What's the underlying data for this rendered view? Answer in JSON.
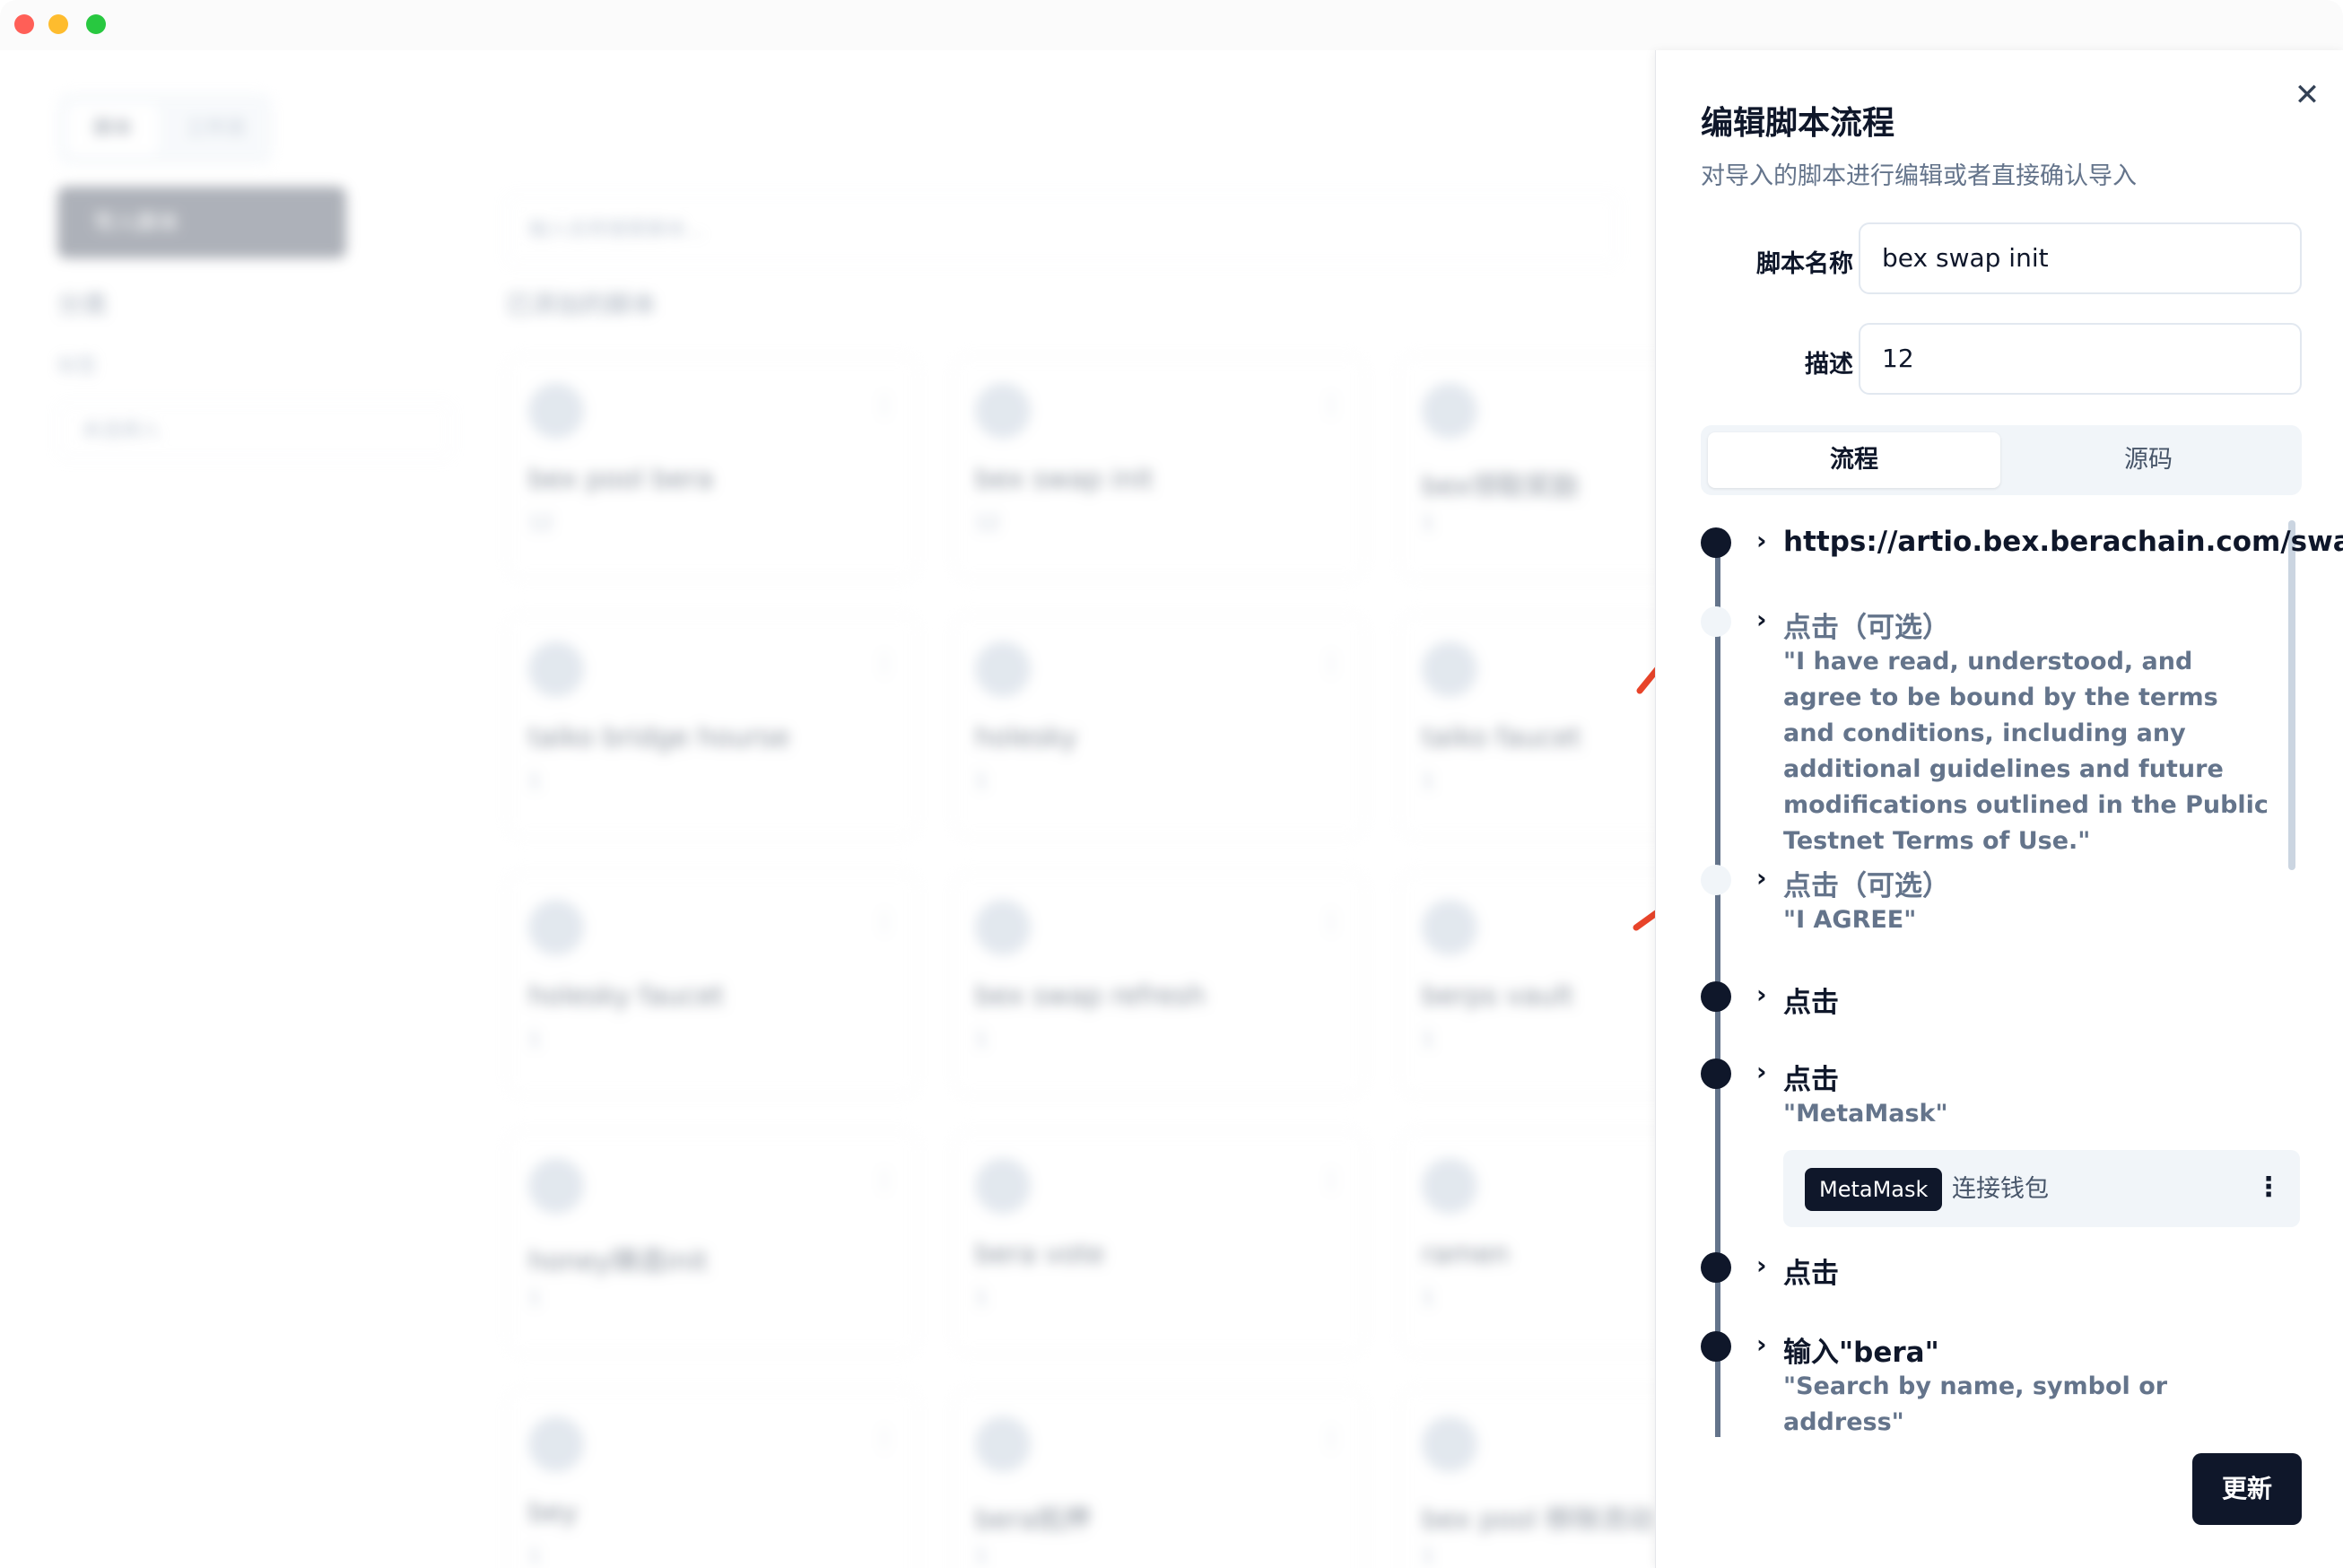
{
  "background_app": {
    "tabs": [
      "脚本",
      "工作流"
    ],
    "primary_button": "导入脚本",
    "sidebar_title": "分类",
    "sidebar_sub": "标签",
    "sidebar_select": "未选择入",
    "search_placeholder": "输入名称搜索脚本...",
    "section_title": "已添加的脚本",
    "cards": [
      {
        "name": "bex pool bera",
        "desc": "12"
      },
      {
        "name": "bex swap init",
        "desc": "12"
      },
      {
        "name": "bex领取奖励",
        "desc": "1"
      },
      {
        "name": "taiko bridge hourse",
        "desc": "1"
      },
      {
        "name": "holesky",
        "desc": "1"
      },
      {
        "name": "taiko faucet",
        "desc": "1"
      },
      {
        "name": "holesky faucet",
        "desc": "1"
      },
      {
        "name": "bex swap refresh",
        "desc": "1"
      },
      {
        "name": "berps vault",
        "desc": "1"
      },
      {
        "name": "honey铸造init",
        "desc": "1"
      },
      {
        "name": "bera vote",
        "desc": "1"
      },
      {
        "name": "ramen",
        "desc": "1"
      },
      {
        "name": "bey",
        "desc": "1"
      },
      {
        "name": "bera抵押",
        "desc": "1"
      },
      {
        "name": "bex pool 移除流动",
        "desc": "1"
      }
    ]
  },
  "drawer": {
    "close_icon": "close-icon",
    "title": "编辑脚本流程",
    "subtitle": "对导入的脚本进行编辑或者直接确认导入",
    "name_label": "脚本名称",
    "name_value": "bex swap init",
    "desc_label": "描述",
    "desc_value": "12",
    "tabs": {
      "flow": "流程",
      "source": "源码"
    },
    "steps": [
      {
        "title": "https://artio.bex.berachain.com/swap",
        "desc": ""
      },
      {
        "title": "点击（可选）",
        "desc": "\"I have read, understood, and agree to be bound by the terms and conditions, including any additional guidelines and future modifications outlined in the Public Testnet Terms of Use.\""
      },
      {
        "title": "点击（可选）",
        "desc": "\"I AGREE\""
      },
      {
        "title": "点击",
        "desc": ""
      },
      {
        "title": "点击",
        "desc": "\"MetaMask\""
      },
      {
        "title": "点击",
        "desc": ""
      },
      {
        "title": "输入\"bera\"",
        "desc": "\"Search by name, symbol or address\""
      }
    ],
    "wallet": {
      "tag": "MetaMask",
      "text": "连接钱包",
      "menu_icon": "more-vertical-icon"
    },
    "update_button": "更新"
  },
  "colors": {
    "primary": "#0f172a",
    "muted": "#64748b",
    "annotation_arrow": "#e8442a"
  }
}
